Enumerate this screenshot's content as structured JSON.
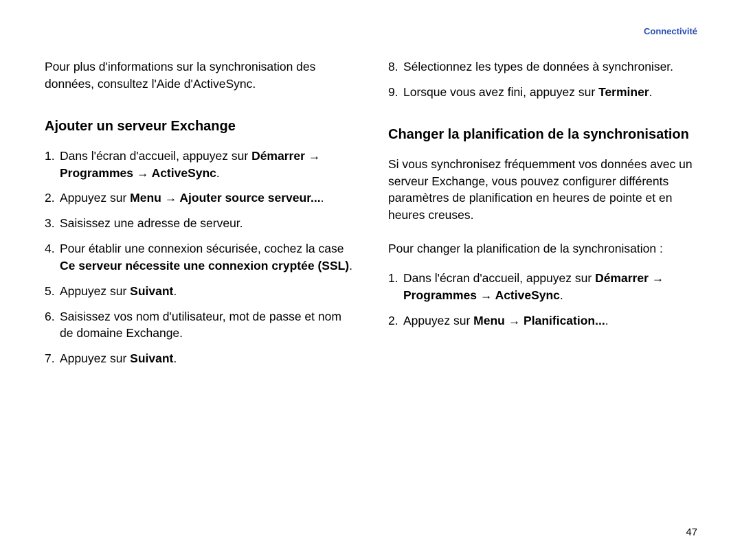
{
  "header": {
    "section_label": "Connectivité"
  },
  "left": {
    "intro": "Pour plus d'informations sur la synchronisation des données, consultez l'Aide d'ActiveSync.",
    "heading": "Ajouter un serveur Exchange",
    "items": [
      {
        "num": "1.",
        "pre": "Dans l'écran d'accueil, appuyez sur ",
        "bold": "Démarrer → Programmes → ActiveSync",
        "post": "."
      },
      {
        "num": "2.",
        "pre": "Appuyez sur ",
        "bold": "Menu → Ajouter source serveur...",
        "post": "."
      },
      {
        "num": "3.",
        "pre": "Saisissez une adresse de serveur.",
        "bold": "",
        "post": ""
      },
      {
        "num": "4.",
        "pre": "Pour établir une connexion sécurisée, cochez la case ",
        "bold": "Ce serveur nécessite une connexion cryptée (SSL)",
        "post": "."
      },
      {
        "num": "5.",
        "pre": "Appuyez sur ",
        "bold": "Suivant",
        "post": "."
      },
      {
        "num": "6.",
        "pre": "Saisissez vos nom d'utilisateur, mot de passe et nom de domaine Exchange.",
        "bold": "",
        "post": ""
      },
      {
        "num": "7.",
        "pre": "Appuyez sur ",
        "bold": "Suivant",
        "post": "."
      }
    ]
  },
  "right": {
    "top_items": [
      {
        "num": "8.",
        "pre": "Sélectionnez les types de données à synchroniser.",
        "bold": "",
        "post": ""
      },
      {
        "num": "9.",
        "pre": "Lorsque vous avez fini, appuyez sur ",
        "bold": "Terminer",
        "post": "."
      }
    ],
    "heading": "Changer la planification de la synchronisation",
    "para1": "Si vous synchronisez fréquemment vos données avec un serveur Exchange, vous pouvez configurer différents paramètres de planification en heures de pointe et en heures creuses.",
    "para2": "Pour changer la planification de la synchronisation :",
    "items": [
      {
        "num": "1.",
        "pre": "Dans l'écran d'accueil, appuyez sur ",
        "bold": "Démarrer → Programmes → ActiveSync",
        "post": "."
      },
      {
        "num": "2.",
        "pre": "Appuyez sur ",
        "bold": "Menu → Planification...",
        "post": "."
      }
    ]
  },
  "page_number": "47"
}
